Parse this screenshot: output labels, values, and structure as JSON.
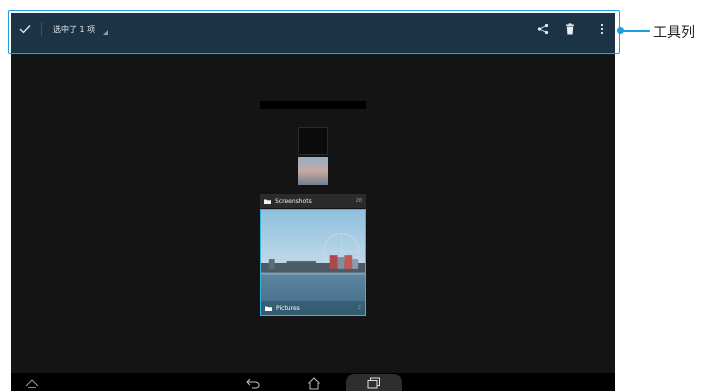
{
  "toolbar": {
    "done_icon": "check-icon",
    "selection_text": "选中了 1 项",
    "share_icon": "share-icon",
    "delete_icon": "trash-icon",
    "overflow_icon": "more-vert-icon",
    "background": "#1b3344"
  },
  "callout": {
    "label": "工具列",
    "color": "#1e9ee0"
  },
  "albums": [
    {
      "name": "Screenshots",
      "count": "28",
      "selected": false
    },
    {
      "name": "Pictures",
      "count": "2",
      "selected": true
    }
  ],
  "navbar": {
    "icons": [
      "collapse-up-icon",
      "back-icon",
      "home-icon",
      "recent-apps-icon"
    ]
  },
  "colors": {
    "selection_border": "#33b5e5",
    "screen_background": "#141414"
  }
}
